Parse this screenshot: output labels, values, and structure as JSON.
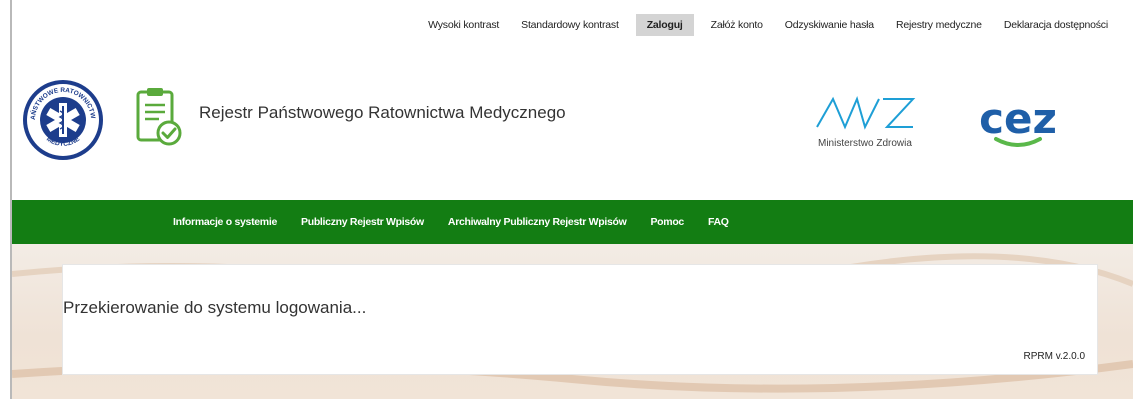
{
  "top_nav": {
    "items": [
      {
        "label": "Wysoki kontrast",
        "active": false
      },
      {
        "label": "Standardowy kontrast",
        "active": false
      },
      {
        "label": "Zaloguj",
        "active": true
      },
      {
        "label": "Załóż konto",
        "active": false
      },
      {
        "label": "Odzyskiwanie hasła",
        "active": false
      },
      {
        "label": "Rejestry medyczne",
        "active": false
      },
      {
        "label": "Deklaracja dostępności",
        "active": false
      }
    ]
  },
  "header": {
    "title": "Rejestr Państwowego Ratownictwa Medycznego",
    "prm_logo_text_top": "PAŃSTWOWE RATOWNICTWO",
    "prm_logo_text_bottom": "MEDYCZNE",
    "mz_logo_text": "Ministerstwo Zdrowia",
    "cez_logo_text": "cez"
  },
  "main_nav": {
    "items": [
      {
        "label": "Informacje o systemie"
      },
      {
        "label": "Publiczny Rejestr Wpisów"
      },
      {
        "label": "Archiwalny Publiczny Rejestr Wpisów"
      },
      {
        "label": "Pomoc"
      },
      {
        "label": "FAQ"
      }
    ]
  },
  "content": {
    "message": "Przekierowanie do systemu logowania...",
    "version": "RPRM v.2.0.0"
  },
  "colors": {
    "nav_green": "#137d13",
    "prm_blue": "#1d3d8c",
    "clipboard_green": "#5aaa3c",
    "mz_teal": "#1e9fd6",
    "cez_blue": "#1f5fa8",
    "cez_green": "#5ab84a"
  }
}
